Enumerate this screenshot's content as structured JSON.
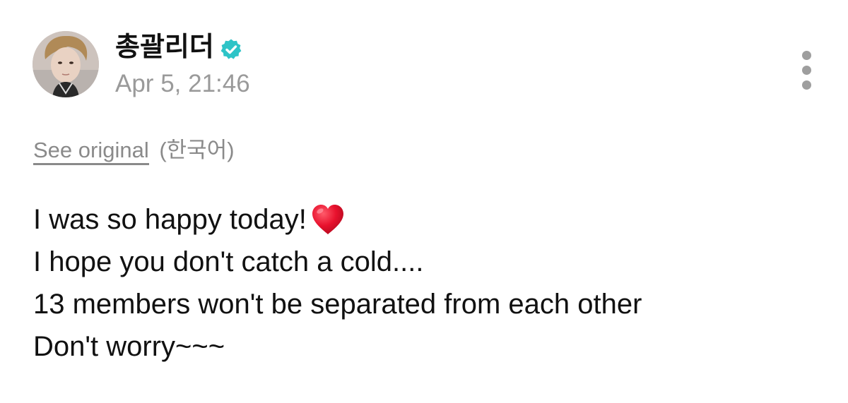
{
  "post": {
    "author": {
      "name": "총괄리더",
      "verified": true,
      "avatar_icon": "profile-photo"
    },
    "timestamp": "Apr 5, 21:46",
    "more_icon": "vertical-dots-icon",
    "translation": {
      "see_original": "See original",
      "language": "(한국어)"
    },
    "body_lines": [
      "I was so happy today!",
      "I hope you don't catch a cold....",
      "13 members won't be separated from each other",
      "Don't worry~~~"
    ],
    "emoji": "heart-icon"
  },
  "colors": {
    "verified_badge": "#2ec4c7",
    "heart": "#e8112d",
    "muted_text": "#9a9a9a"
  }
}
